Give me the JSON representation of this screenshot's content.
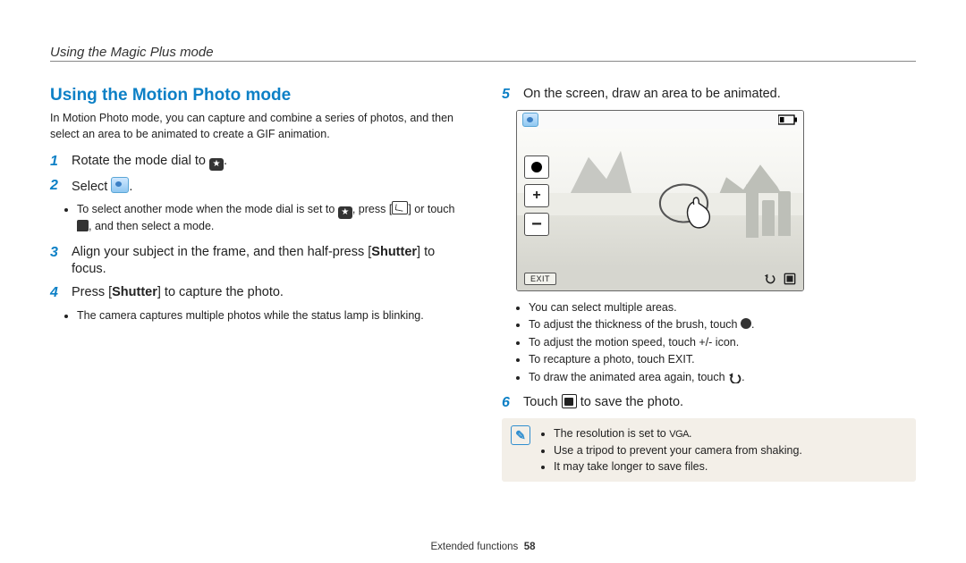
{
  "chapter": "Using the Magic Plus mode",
  "section_title": "Using the Motion Photo mode",
  "intro": "In Motion Photo mode, you can capture and combine a series of photos, and then select an area to be animated to create a GIF animation.",
  "steps": {
    "s1": "Rotate the mode dial to ",
    "s1_end": ".",
    "s2": "Select ",
    "s2_end": ".",
    "s2_sub": [
      "To select another mode when the mode dial is set to ",
      ", press [",
      "] or touch ",
      ", and then select a mode."
    ],
    "s3_a": "Align your subject in the frame, and then half-press [",
    "s3_shutter": "Shutter",
    "s3_b": "] to focus.",
    "s4_a": "Press [",
    "s4_shutter": "Shutter",
    "s4_b": "] to capture the photo.",
    "s4_sub": "The camera captures multiple photos while the status lamp is blinking.",
    "s5": "On the screen, draw an area to be animated.",
    "s5_subs": {
      "a": "You can select multiple areas.",
      "b": "To adjust the thickness of the brush, touch ",
      "b_end": ".",
      "c": "To adjust the motion speed, touch +/- icon.",
      "d_a": "To recapture a photo, touch ",
      "d_exit": "EXIT",
      "d_b": ".",
      "e": "To draw the animated area again, touch ",
      "e_end": "."
    },
    "s6_a": "Touch ",
    "s6_b": " to save the photo."
  },
  "screenshot": {
    "exit_label": "EXIT"
  },
  "notes": {
    "a_pre": "The resolution is set to ",
    "a_vga": "VGA",
    "a_post": ".",
    "b": "Use a tripod to prevent your camera from shaking.",
    "c": "It may take longer to save files."
  },
  "footer": {
    "section": "Extended functions",
    "page": "58"
  }
}
